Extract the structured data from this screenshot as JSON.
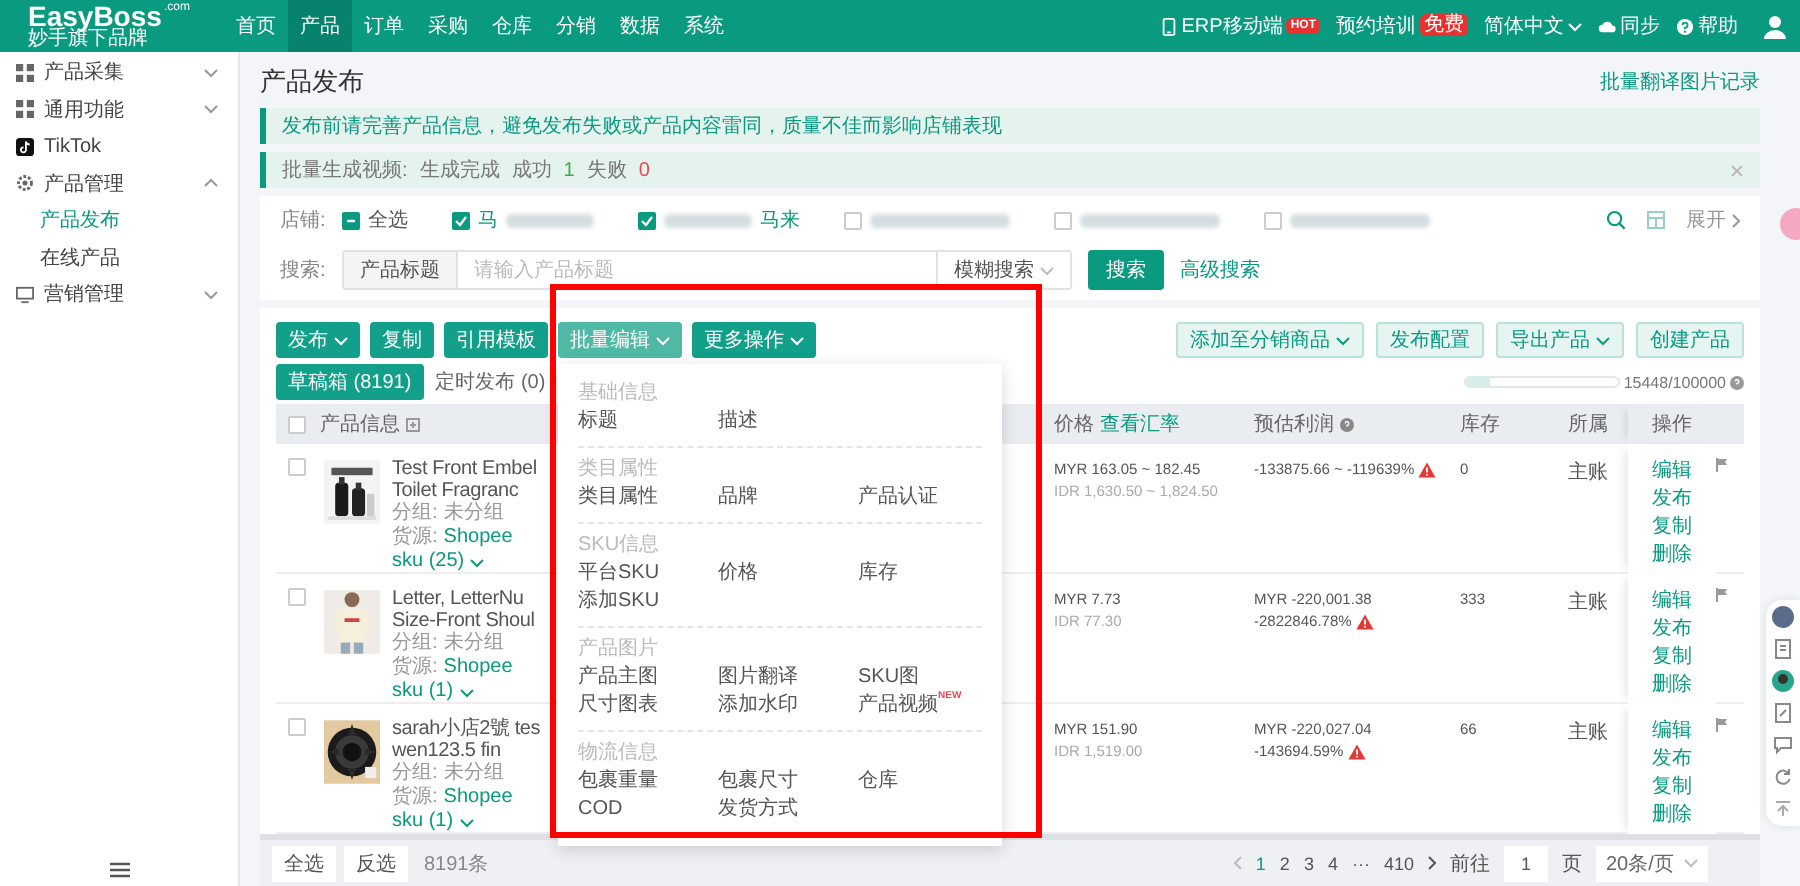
{
  "nav": {
    "logo": "EasyBoss",
    "logo_suffix": ".com",
    "tagline": "妙手旗下品牌",
    "menu": [
      {
        "label": "首页",
        "selected": false
      },
      {
        "label": "产品",
        "selected": true
      },
      {
        "label": "订单",
        "selected": false
      },
      {
        "label": "采购",
        "selected": false
      },
      {
        "label": "仓库",
        "selected": false
      },
      {
        "label": "分销",
        "selected": false
      },
      {
        "label": "数据",
        "selected": false
      },
      {
        "label": "系统",
        "selected": false
      }
    ],
    "tools": [
      {
        "kind": "mobile",
        "label": "ERP移动端",
        "badge": "HOT"
      },
      {
        "kind": "plain",
        "label": "预约培训",
        "badge": "免费"
      },
      {
        "kind": "language",
        "label": "简体中文"
      },
      {
        "kind": "sync",
        "label": "同步"
      },
      {
        "kind": "help",
        "label": "帮助"
      }
    ]
  },
  "sidebar": {
    "items": [
      {
        "kind": "grid",
        "label": "产品采集",
        "expanded": false
      },
      {
        "kind": "grid",
        "label": "通用功能",
        "expanded": false
      },
      {
        "kind": "tiktok",
        "label": "TikTok"
      },
      {
        "kind": "gear",
        "label": "产品管理",
        "expanded": true,
        "children": [
          {
            "label": "产品发布",
            "selected": true
          },
          {
            "label": "在线产品",
            "selected": false
          }
        ]
      },
      {
        "kind": "monitor",
        "label": "营销管理",
        "expanded": false
      }
    ]
  },
  "page": {
    "title": "产品发布",
    "link": "批量翻译图片记录"
  },
  "notices": [
    {
      "kind": "info",
      "text": "发布前请完善产品信息，避免发布失败或产品内容雷同，质量不佳而影响店铺表现",
      "closable": false
    },
    {
      "kind": "task",
      "label": "批量生成视频:",
      "status": "生成完成",
      "success_label": "成功",
      "success": "1",
      "fail_label": "失败",
      "fail": "0",
      "closable": true
    }
  ],
  "filters": {
    "shop_label": "店铺:",
    "shops": [
      {
        "kind": "all",
        "label": "全选",
        "indeterminate": true
      },
      {
        "kind": "prefix",
        "label": "马",
        "checked": true
      },
      {
        "kind": "suffix",
        "label": "马来",
        "checked": true
      },
      {
        "kind": "hidden",
        "checked": false
      },
      {
        "kind": "hidden",
        "checked": false
      },
      {
        "kind": "hidden",
        "checked": false
      }
    ],
    "expand": "展开",
    "search_label": "搜索:",
    "field": "产品标题",
    "placeholder": "请输入产品标题",
    "mode": "模糊搜索",
    "button": "搜索",
    "advanced": "高级搜索"
  },
  "toolbar": {
    "left": [
      {
        "label": "发布",
        "kind": "primary",
        "caret": true
      },
      {
        "label": "复制",
        "kind": "primary",
        "caret": false
      },
      {
        "label": "引用模板",
        "kind": "primary",
        "caret": false
      },
      {
        "label": "批量编辑",
        "kind": "open",
        "caret": true
      },
      {
        "label": "更多操作",
        "kind": "primary",
        "caret": true
      }
    ],
    "right": [
      {
        "label": "添加至分销商品",
        "caret": true
      },
      {
        "label": "发布配置",
        "caret": false
      },
      {
        "label": "导出产品",
        "caret": true
      },
      {
        "label": "创建产品",
        "caret": false
      }
    ]
  },
  "tabs": [
    {
      "label": "草稿箱 (8191)",
      "selected": true
    },
    {
      "label": "定时发布 (0)",
      "selected": false
    }
  ],
  "quota": {
    "level": 0.154,
    "text": "15448/100000"
  },
  "dropdown": {
    "sections": [
      {
        "title": "基础信息",
        "items": [
          {
            "label": "标题"
          },
          {
            "label": "描述"
          }
        ]
      },
      {
        "title": "类目属性",
        "items": [
          {
            "label": "类目属性"
          },
          {
            "label": "品牌"
          },
          {
            "label": "产品认证"
          }
        ]
      },
      {
        "title": "SKU信息",
        "items": [
          {
            "label": "平台SKU"
          },
          {
            "label": "价格"
          },
          {
            "label": "库存"
          },
          {
            "label": "添加SKU"
          }
        ]
      },
      {
        "title": "产品图片",
        "items": [
          {
            "label": "产品主图"
          },
          {
            "label": "图片翻译"
          },
          {
            "label": "SKU图"
          },
          {
            "label": "尺寸图表"
          },
          {
            "label": "添加水印"
          },
          {
            "label": "产品视频",
            "badge": "NEW"
          }
        ]
      },
      {
        "title": "物流信息",
        "items": [
          {
            "label": "包裹重量"
          },
          {
            "label": "包裹尺寸"
          },
          {
            "label": "仓库"
          },
          {
            "label": "COD"
          },
          {
            "label": "发货方式"
          }
        ]
      }
    ]
  },
  "highlight": {
    "kind": "frame"
  },
  "table": {
    "select_all_checked": false,
    "columns": {
      "product": "产品信息",
      "price": "价格",
      "price_link": "查看汇率",
      "profit": "预估利润",
      "stock": "库存",
      "owner": "所属",
      "actions": "操作"
    },
    "rows": [
      {
        "checked": false,
        "title_lines": [
          "Test Front Embel",
          "Toilet Fragranc"
        ],
        "group_label": "分组:",
        "group": "未分组",
        "source_label": "货源:",
        "source": "Shopee",
        "sku": "sku (25)",
        "price": "MYR 163.05 ~ 182.45",
        "price_alt": "IDR 1,630.50 ~ 1,824.50",
        "profit_lines": [
          "-133875.66 ~ -119639%"
        ],
        "warning": true,
        "stock": "0",
        "owner": "主账",
        "actions": [
          "编辑",
          "发布",
          "复制",
          "删除"
        ]
      },
      {
        "checked": false,
        "title_lines": [
          "Letter, LetterNu",
          "Size-Front Shoul"
        ],
        "group_label": "分组:",
        "group": "未分组",
        "source_label": "货源:",
        "source": "Shopee",
        "sku": "sku (1)",
        "price": "MYR 7.73",
        "price_alt": "IDR 77.30",
        "profit_lines": [
          "MYR -220,001.38",
          "-2822846.78%"
        ],
        "warning": true,
        "stock": "333",
        "owner": "主账",
        "actions": [
          "编辑",
          "发布",
          "复制",
          "删除"
        ]
      },
      {
        "checked": false,
        "title_lines": [
          "sarah小店2號 tes",
          "wen123.5 fin"
        ],
        "group_label": "分组:",
        "group": "未分组",
        "source_label": "货源:",
        "source": "Shopee",
        "sku": "sku (1)",
        "price": "MYR 151.90",
        "price_alt": "IDR 1,519.00",
        "profit_lines": [
          "MYR -220,027.04",
          "-143694.59%"
        ],
        "warning": true,
        "stock": "66",
        "owner": "主账",
        "actions": [
          "编辑",
          "发布",
          "复制",
          "删除"
        ]
      }
    ]
  },
  "footer": {
    "select_all": "全选",
    "invert": "反选",
    "total": "8191条",
    "pages": [
      {
        "kind": "page",
        "label": "1",
        "selected": true
      },
      {
        "kind": "page",
        "label": "2",
        "selected": false
      },
      {
        "kind": "page",
        "label": "3",
        "selected": false
      },
      {
        "kind": "page",
        "label": "4",
        "selected": false
      },
      {
        "kind": "ellipsis",
        "label": "···"
      },
      {
        "kind": "page",
        "label": "410",
        "selected": false
      }
    ],
    "goto": "前往",
    "page_value": "1",
    "page_unit": "页",
    "page_size": "20条/页"
  }
}
